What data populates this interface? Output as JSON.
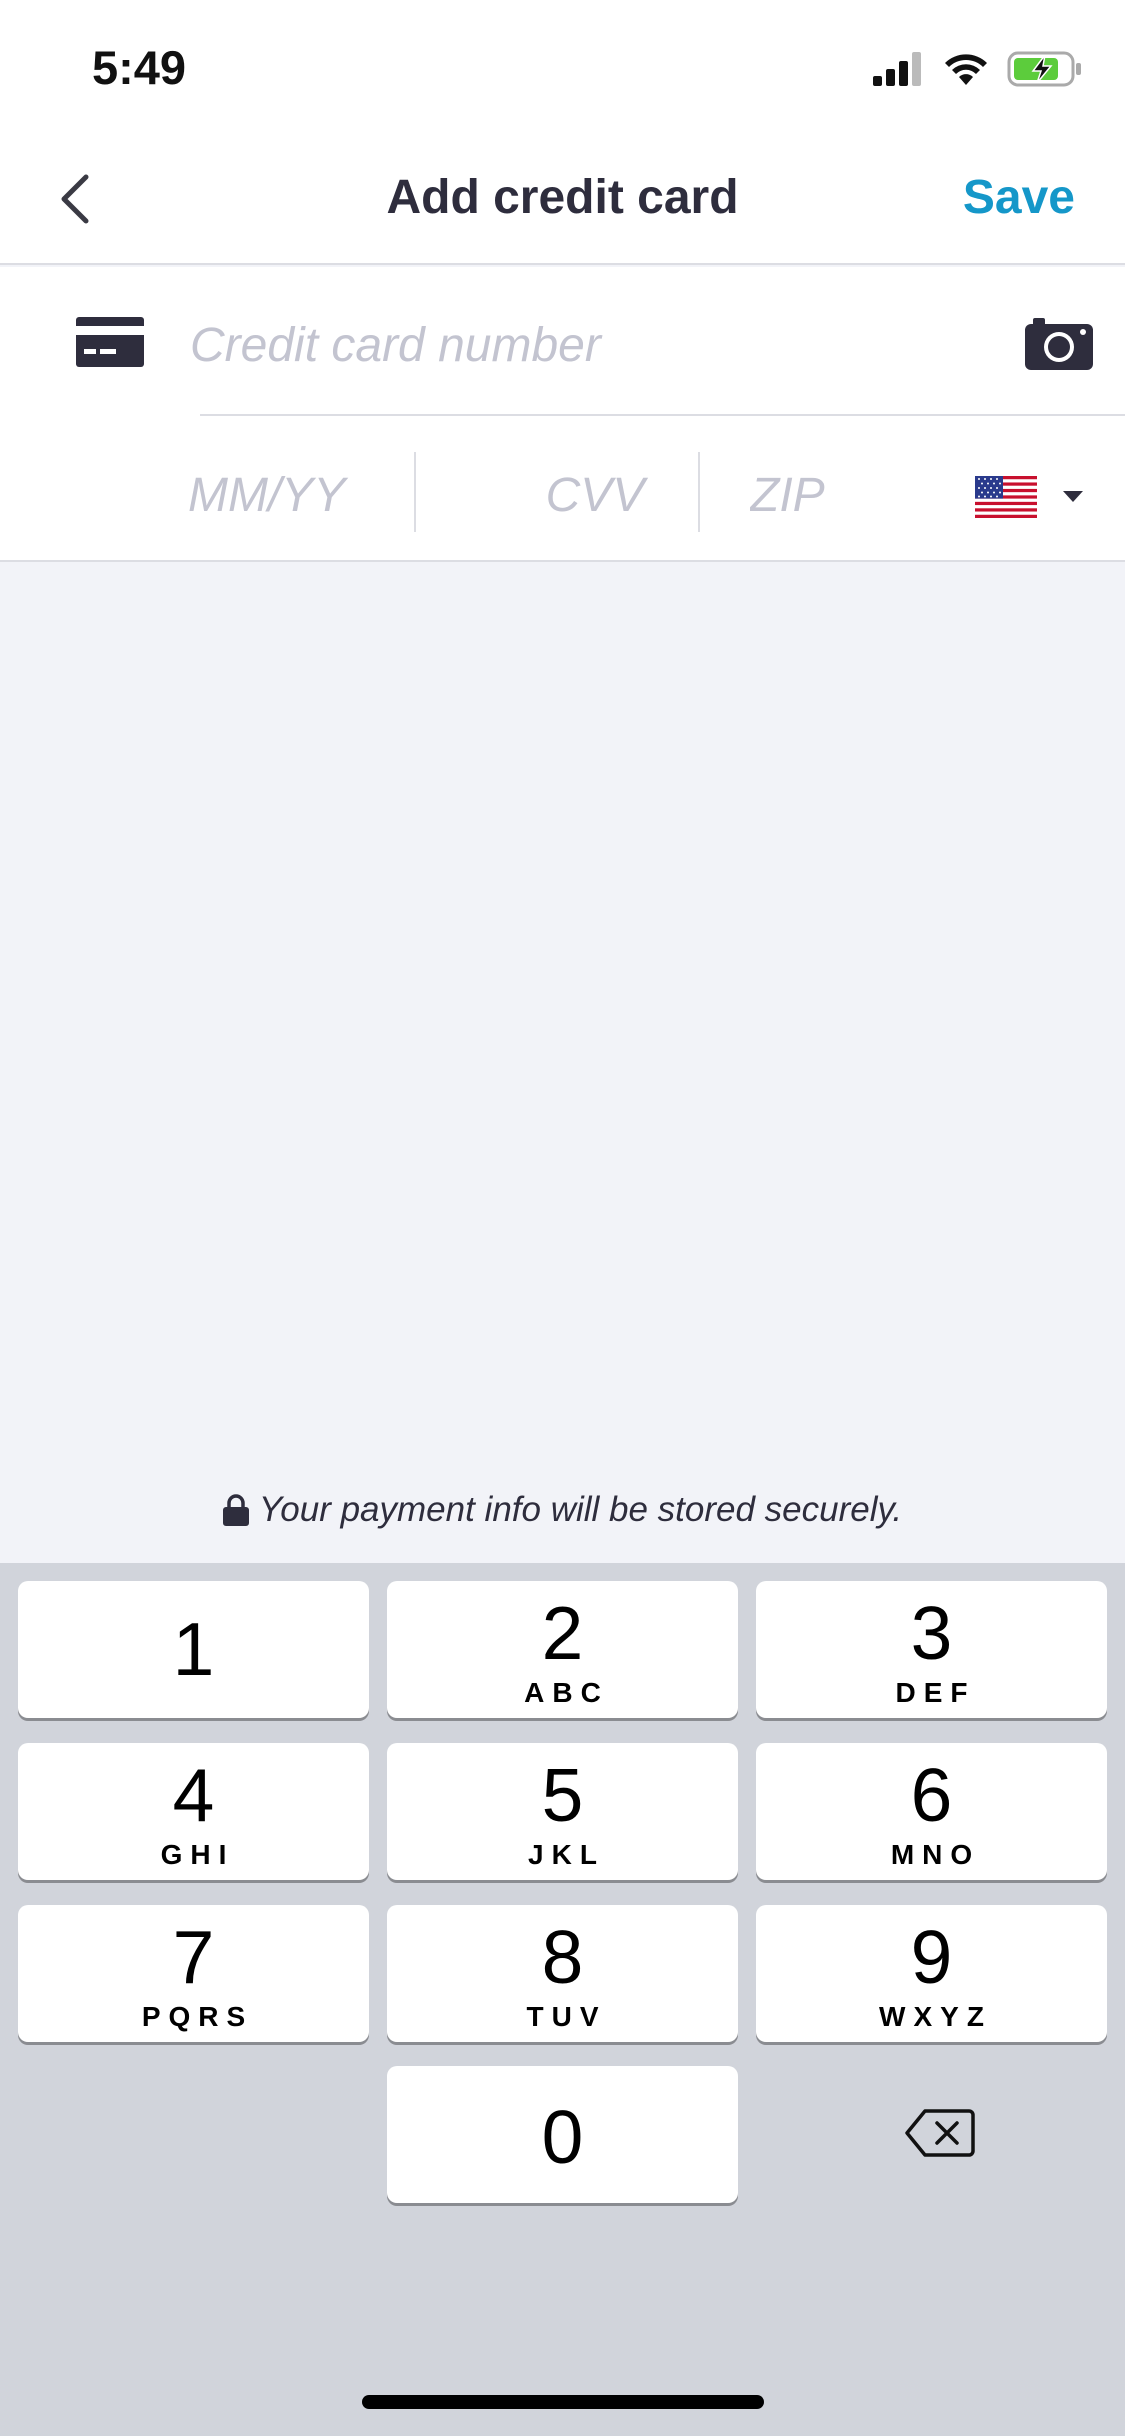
{
  "status_bar": {
    "time": "5:49"
  },
  "nav": {
    "title": "Add credit card",
    "save_label": "Save"
  },
  "form": {
    "card_number_placeholder": "Credit card number",
    "expiry_placeholder": "MM/YY",
    "cvv_placeholder": "CVV",
    "zip_placeholder": "ZIP",
    "country_flag": "us-flag-icon"
  },
  "secure_note": "Your payment info will be stored securely.",
  "keyboard": {
    "keys": [
      {
        "digit": "1",
        "letters": ""
      },
      {
        "digit": "2",
        "letters": "ABC"
      },
      {
        "digit": "3",
        "letters": "DEF"
      },
      {
        "digit": "4",
        "letters": "GHI"
      },
      {
        "digit": "5",
        "letters": "JKL"
      },
      {
        "digit": "6",
        "letters": "MNO"
      },
      {
        "digit": "7",
        "letters": "PQRS"
      },
      {
        "digit": "8",
        "letters": "TUV"
      },
      {
        "digit": "9",
        "letters": "WXYZ"
      },
      {
        "digit": "0",
        "letters": ""
      }
    ]
  },
  "colors": {
    "accent": "#1597c9",
    "title": "#2e2d3d",
    "placeholder": "#c3c4d0",
    "keyboard_bg": "#d1d4db"
  }
}
